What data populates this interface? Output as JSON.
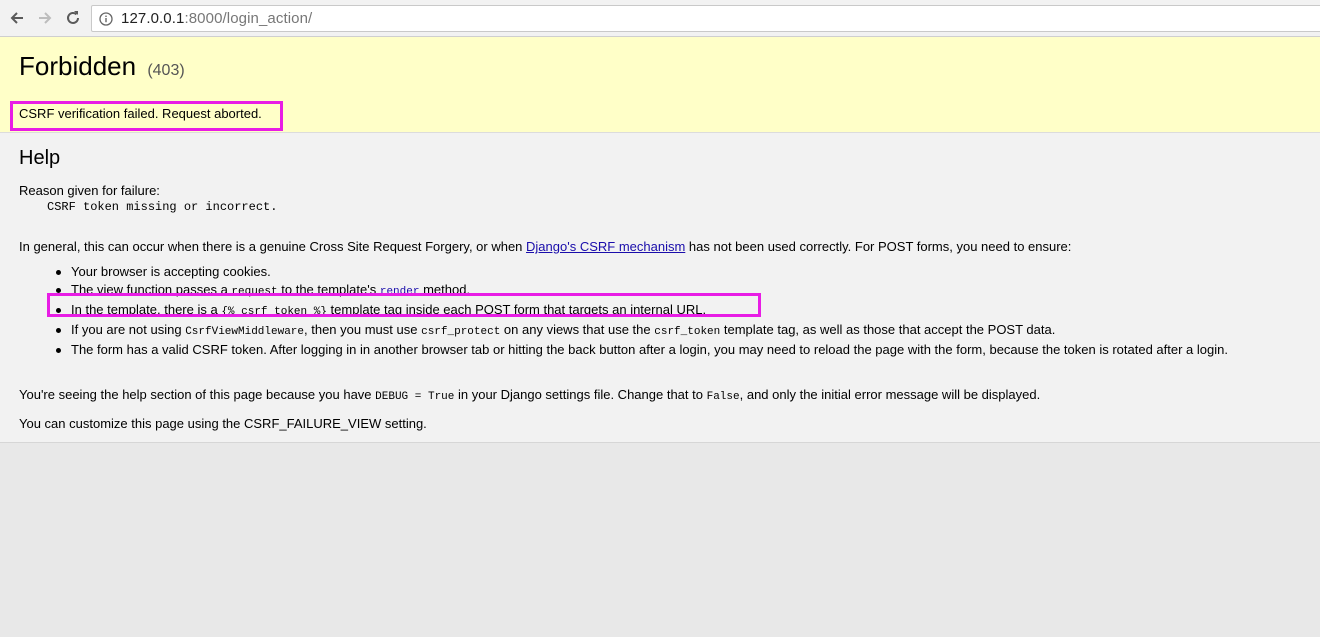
{
  "browser": {
    "url_host": "127.0.0.1",
    "url_rest": ":8000/login_action/"
  },
  "summary": {
    "title": "Forbidden",
    "status_code": "(403)",
    "message": "CSRF verification failed. Request aborted."
  },
  "help": {
    "heading": "Help",
    "reason_label": "Reason given for failure:",
    "reason_code": "CSRF token missing or incorrect.",
    "general_before": "In general, this can occur when there is a genuine Cross Site Request Forgery, or when ",
    "general_link": "Django's CSRF mechanism",
    "general_after": " has not been used correctly. For POST forms, you need to ensure:",
    "items": {
      "b1": "Your browser is accepting cookies.",
      "b2_a": "The view function passes a ",
      "b2_code": "request",
      "b2_b": " to the template's ",
      "b2_link": "render",
      "b2_c": " method.",
      "b3_a": "In the template, there is a ",
      "b3_code": "{% csrf_token %}",
      "b3_b": " template tag inside each POST form that targets an internal URL.",
      "b4_a": "If you are not using ",
      "b4_code1": "CsrfViewMiddleware",
      "b4_b": ", then you must use ",
      "b4_code2": "csrf_protect",
      "b4_c": " on any views that use the ",
      "b4_code3": "csrf_token",
      "b4_d": " template tag, as well as those that accept the POST data.",
      "b5": "The form has a valid CSRF token. After logging in in another browser tab or hitting the back button after a login, you may need to reload the page with the form, because the token is rotated after a login."
    },
    "debug_a": "You're seeing the help section of this page because you have ",
    "debug_code1": "DEBUG = True",
    "debug_b": " in your Django settings file. Change that to ",
    "debug_code2": "False",
    "debug_c": ", and only the initial error message will be displayed.",
    "customize": "You can customize this page using the CSRF_FAILURE_VIEW setting."
  },
  "colors": {
    "summary_bg": "#ffffc8",
    "highlight": "#e81de5",
    "link": "#1a0dab"
  }
}
